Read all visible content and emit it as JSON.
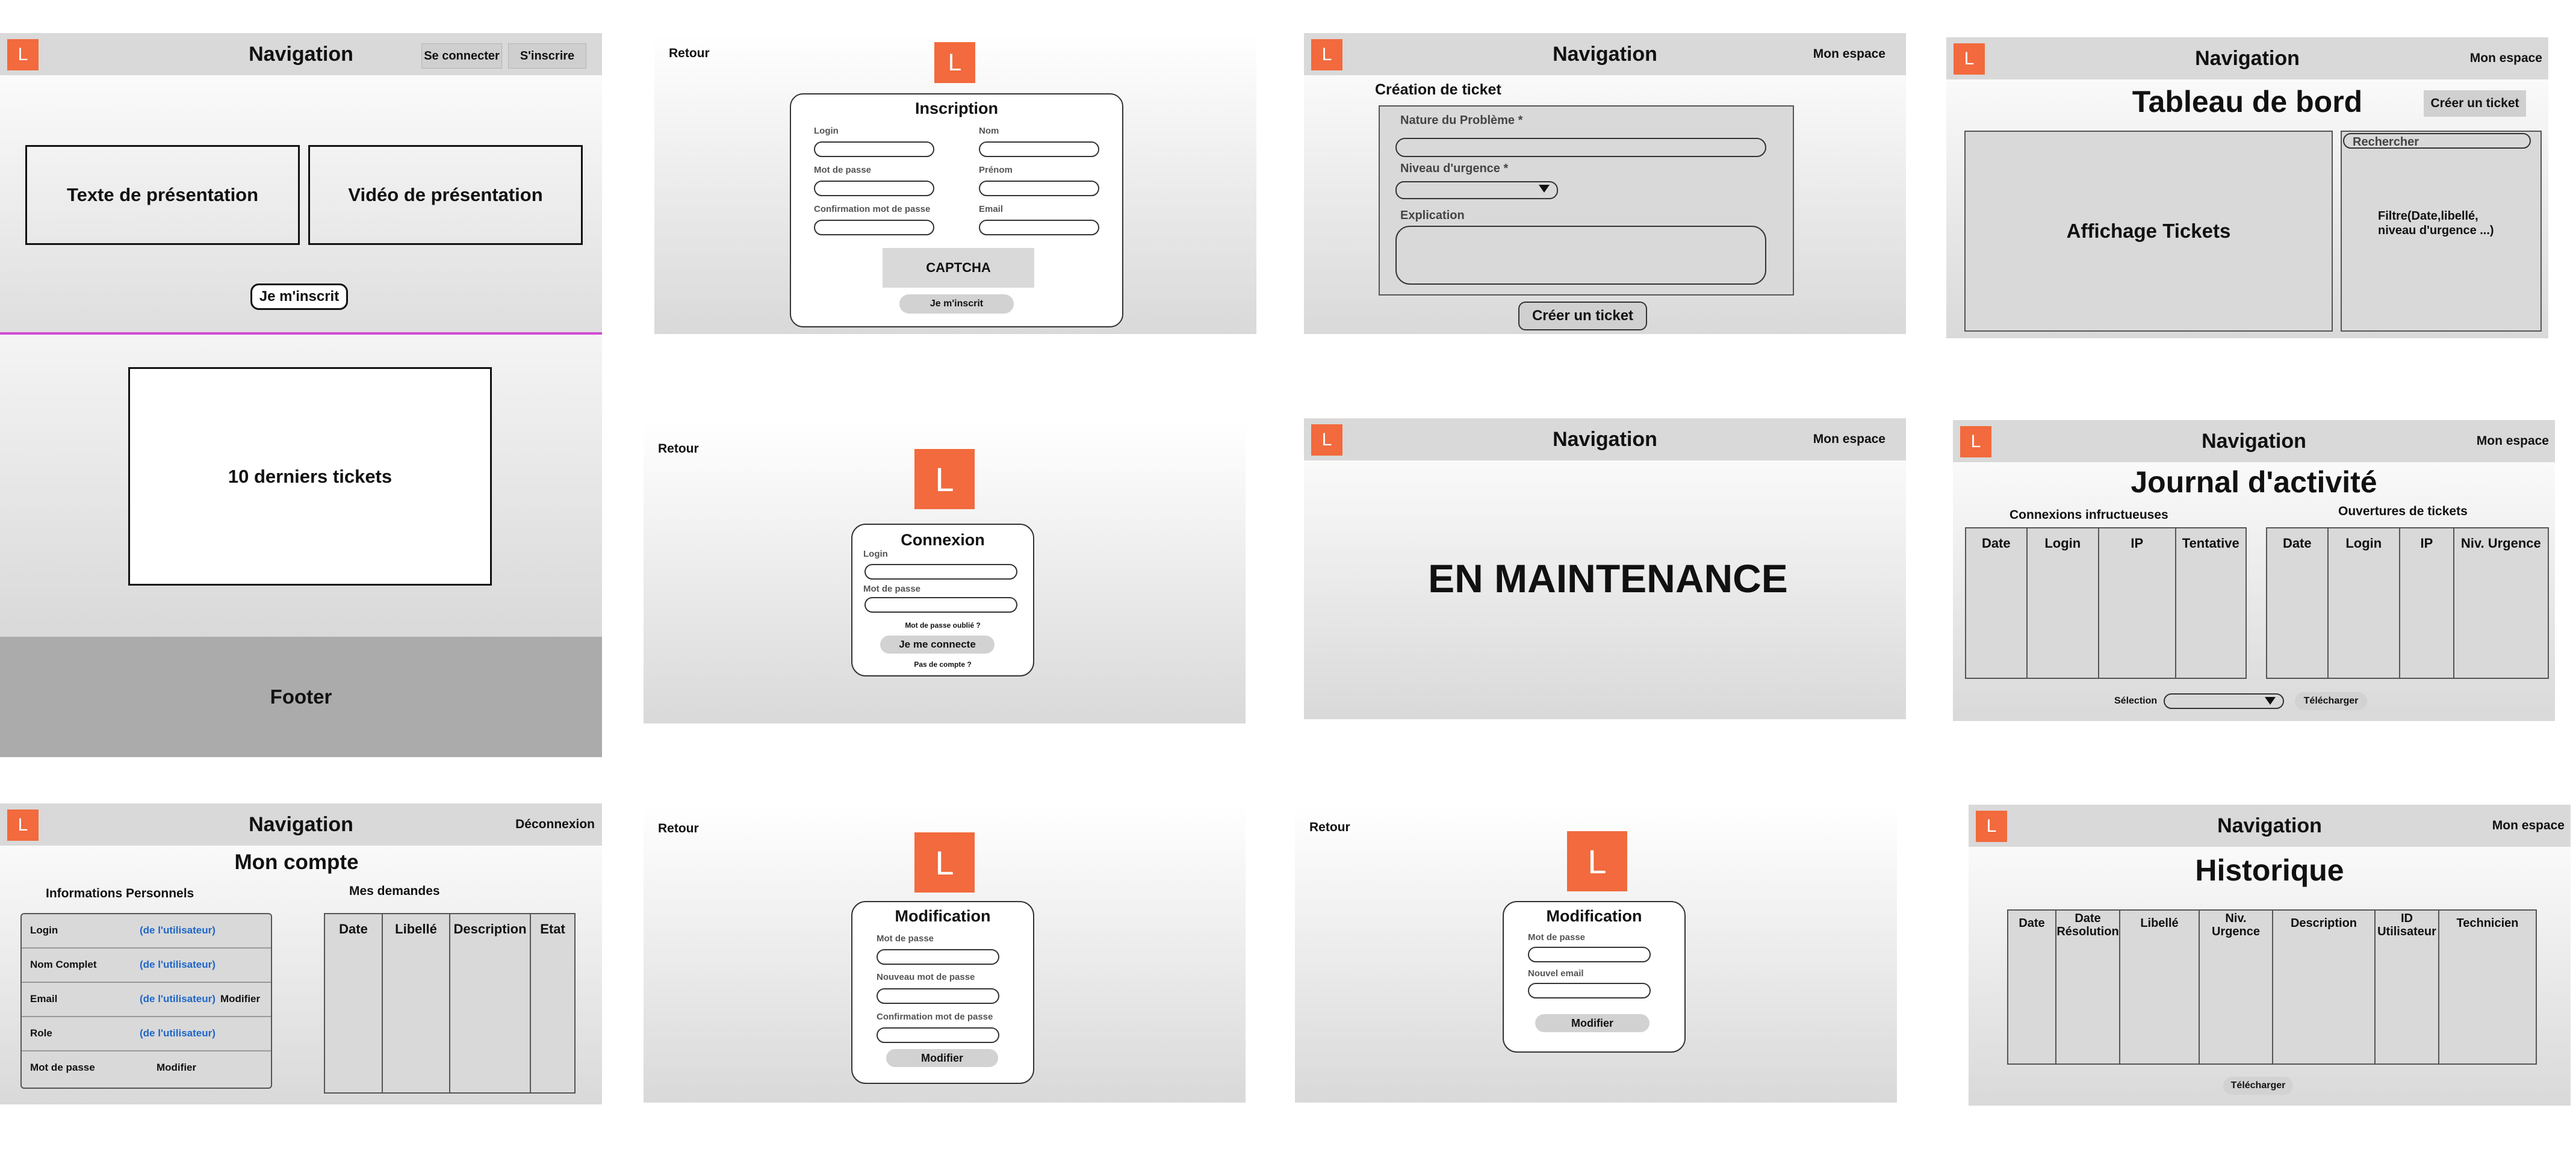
{
  "brand": {
    "logo_letter": "L",
    "accent": "#f26a3d"
  },
  "home": {
    "nav_title": "Navigation",
    "login_button": "Se connecter",
    "signup_button": "S'inscrire",
    "presentation_text": "Texte de présentation",
    "presentation_video": "Vidéo de présentation",
    "cta": "Je m'inscrit",
    "last_tickets": "10 derniers tickets",
    "footer": "Footer"
  },
  "signup": {
    "back": "Retour",
    "title": "Inscription",
    "login_label": "Login",
    "password_label": "Mot de passe",
    "confirm_label": "Confirmation mot de passe",
    "lastname_label": "Nom",
    "firstname_label": "Prénom",
    "email_label": "Email",
    "captcha": "CAPTCHA",
    "submit": "Je m'inscrit"
  },
  "create_ticket": {
    "nav_title": "Navigation",
    "nav_right": "Mon espace",
    "heading": "Création de ticket",
    "nature_label": "Nature du Problème *",
    "urgency_label": "Niveau d'urgence *",
    "explanation_label": "Explication",
    "submit": "Créer un ticket"
  },
  "dashboard": {
    "nav_title": "Navigation",
    "nav_right": "Mon espace",
    "title": "Tableau de bord",
    "create_button": "Créer un ticket",
    "tickets_panel": "Affichage Tickets",
    "search_placeholder": "Rechercher",
    "filter_text": "Filtre(Date,libellé, niveau d'urgence ...)"
  },
  "login": {
    "back": "Retour",
    "title": "Connexion",
    "login_label": "Login",
    "password_label": "Mot de passe",
    "forgot": "Mot de passe oublié ?",
    "submit": "Je me connecte",
    "no_account": "Pas de compte ?"
  },
  "maintenance": {
    "nav_title": "Navigation",
    "nav_right": "Mon espace",
    "message": "EN MAINTENANCE"
  },
  "activity": {
    "nav_title": "Navigation",
    "nav_right": "Mon espace",
    "title": "Journal d'activité",
    "failed_title": "Connexions infructueuses",
    "failed_columns": [
      "Date",
      "Login",
      "IP",
      "Tentative"
    ],
    "openings_title": "Ouvertures de tickets",
    "openings_columns": [
      "Date",
      "Login",
      "IP",
      "Niv. Urgence"
    ],
    "selection_label": "Sélection",
    "download": "Télécharger"
  },
  "account": {
    "nav_title": "Navigation",
    "nav_right": "Déconnexion",
    "title": "Mon compte",
    "personal_title": "Informations Personnels",
    "requests_title": "Mes demandes",
    "rows": [
      {
        "label": "Login",
        "value": "(de l'utilisateur)",
        "action": ""
      },
      {
        "label": "Nom Complet",
        "value": "(de l'utilisateur)",
        "action": ""
      },
      {
        "label": "Email",
        "value": "(de l'utilisateur)",
        "action": "Modifier"
      },
      {
        "label": "Role",
        "value": "(de l'utilisateur)",
        "action": ""
      },
      {
        "label": "Mot de passe",
        "value": "",
        "action": "Modifier"
      }
    ],
    "requests_columns": [
      "Date",
      "Libellé",
      "Description",
      "Etat"
    ]
  },
  "change_password": {
    "title": "Modification",
    "current_label": "Mot de passe",
    "new_label": "Nouveau mot de passe",
    "confirm_label": "Confirmation mot de passe",
    "submit": "Modifier"
  },
  "change_email": {
    "back": "Retour",
    "title": "Modification",
    "password_label": "Mot de passe",
    "email_label": "Nouvel email",
    "submit": "Modifier"
  },
  "history": {
    "nav_title": "Navigation",
    "nav_right": "Mon espace",
    "title": "Historique",
    "columns": [
      "Date",
      "Date Résolution",
      "Libellé",
      "Niv. Urgence",
      "Description",
      "ID Utilisateur",
      "Technicien"
    ],
    "download": "Télécharger"
  }
}
